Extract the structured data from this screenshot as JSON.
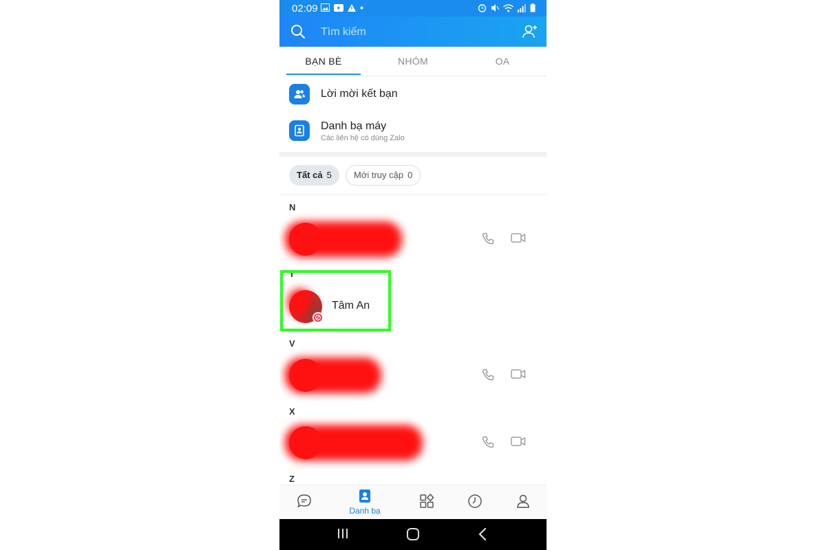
{
  "status_bar": {
    "time": "02:09"
  },
  "search": {
    "placeholder": "Tìm kiếm"
  },
  "tabs": [
    {
      "label": "BẠN BÈ",
      "active": true
    },
    {
      "label": "NHÓM",
      "active": false
    },
    {
      "label": "OA",
      "active": false
    }
  ],
  "menu": {
    "friend_requests": {
      "title": "Lời mời kết bạn"
    },
    "phonebook": {
      "title": "Danh bạ máy",
      "subtitle": "Các liên hệ có dùng Zalo"
    }
  },
  "filters": {
    "all": {
      "label": "Tất cả",
      "count": "5"
    },
    "recent": {
      "label": "Mới truy cập",
      "count": "0"
    }
  },
  "sections": [
    "N",
    "T",
    "V",
    "X",
    "Z"
  ],
  "contacts": {
    "tam_an": {
      "name": "Tâm An"
    }
  },
  "bottom_nav": {
    "active_label": "Danh bạ"
  },
  "colors": {
    "accent": "#1a8cf0",
    "highlight": "#2bff22",
    "redaction": "#ff1111",
    "blocked_badge": "#e8344a"
  }
}
